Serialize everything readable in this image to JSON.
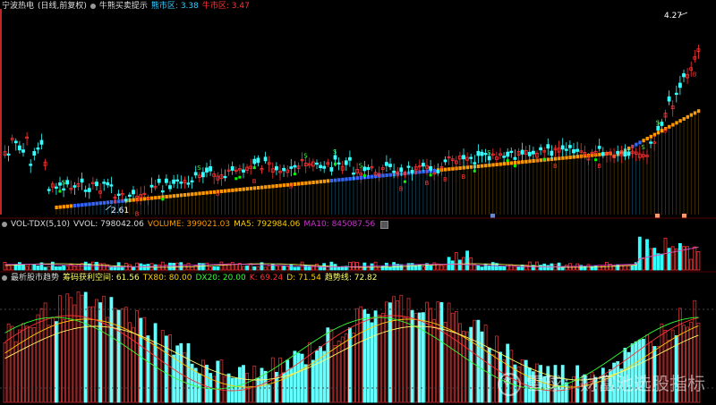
{
  "header": {
    "stock_name": "宁波热电",
    "period": "(日线,前复权)",
    "indicator": "牛熊买卖提示",
    "bear_label": "熊市区: 3.38",
    "bull_label": "牛市区: 3.47",
    "bear_color": "#33ccff",
    "bull_color": "#ff3333"
  },
  "price_panel": {
    "high_label": "4.27",
    "low_label": "2.61",
    "buy_marker": "S",
    "sell_marker": "B"
  },
  "volume_panel": {
    "title": "VOL-TDX(5,10)",
    "vvol": "VVOL: 798042.06",
    "volume": "VOLUME: 399021.03",
    "ma5": "MA5: 792984.06",
    "ma10": "MA10: 845087.56",
    "volume_color": "#ff9900",
    "ma5_color": "#ffcc00",
    "ma10_color": "#cc33cc"
  },
  "indicator_panel": {
    "title": "最析股市趋势",
    "space": "筹码获利空间: 61.56",
    "tx80": "TX80: 80.00",
    "dx20": "DX20: 20.00",
    "k": "K: 69.24",
    "d": "D: 71.54",
    "trend": "趋势线: 72.82",
    "space_color": "#ffff66",
    "tx80_color": "#ffcc00",
    "dx20_color": "#33ff33",
    "k_color": "#ff3333",
    "d_color": "#ffcc00",
    "trend_color": "#ffff66"
  },
  "watermark": {
    "text": "雪球：财富池选股指标"
  }
}
